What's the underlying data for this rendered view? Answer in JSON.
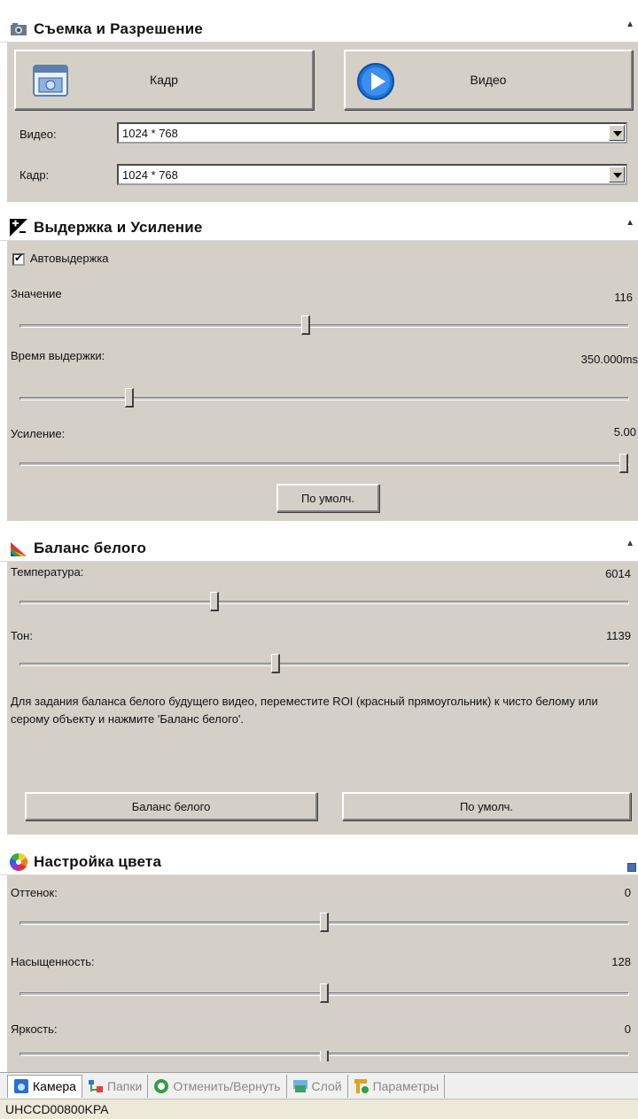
{
  "capture": {
    "title": "Съемка и Разрешение",
    "snapshot_label": "Кадр",
    "video_label": "Видео",
    "video_res_label": "Видео:",
    "video_res_value": "1024 * 768",
    "frame_res_label": "Кадр:",
    "frame_res_value": "1024 * 768"
  },
  "exposure": {
    "title": "Выдержка и Усиление",
    "auto_label": "Автовыдержка",
    "auto_checked": true,
    "value_label": "Значение",
    "value": "116",
    "value_level": 0.47,
    "time_label": "Время выдержки:",
    "time_value": "350.000ms",
    "time_level": 0.18,
    "gain_label": "Усиление:",
    "gain_value": "5.00",
    "gain_level": 1.0,
    "default_label": "По умолч."
  },
  "white_balance": {
    "title": "Баланс белого",
    "temp_label": "Температура:",
    "temp_value": "6014",
    "temp_level": 0.32,
    "tint_label": "Тон:",
    "tint_value": "1139",
    "tint_level": 0.42,
    "description": "Для задания баланса белого будущего видео, переместите ROI (красный прямоугольник) к чисто белому или серому объекту и нажмите 'Баланс белого'.",
    "wb_button_label": "Баланс белого",
    "default_label": "По умолч."
  },
  "color": {
    "title": "Настройка цвета",
    "hue_label": "Оттенок:",
    "hue_value": "0",
    "hue_level": 0.5,
    "saturation_label": "Насыщенность:",
    "saturation_value": "128",
    "saturation_level": 0.5,
    "brightness_label": "Яркость:",
    "brightness_value": "0",
    "brightness_level": 0.5
  },
  "tabs": [
    {
      "label": "Камера",
      "active": true
    },
    {
      "label": "Папки",
      "active": false
    },
    {
      "label": "Отменить/Вернуть",
      "active": false
    },
    {
      "label": "Слой",
      "active": false
    },
    {
      "label": "Параметры",
      "active": false
    }
  ],
  "status": {
    "device": "UHCCD00800KPA"
  }
}
